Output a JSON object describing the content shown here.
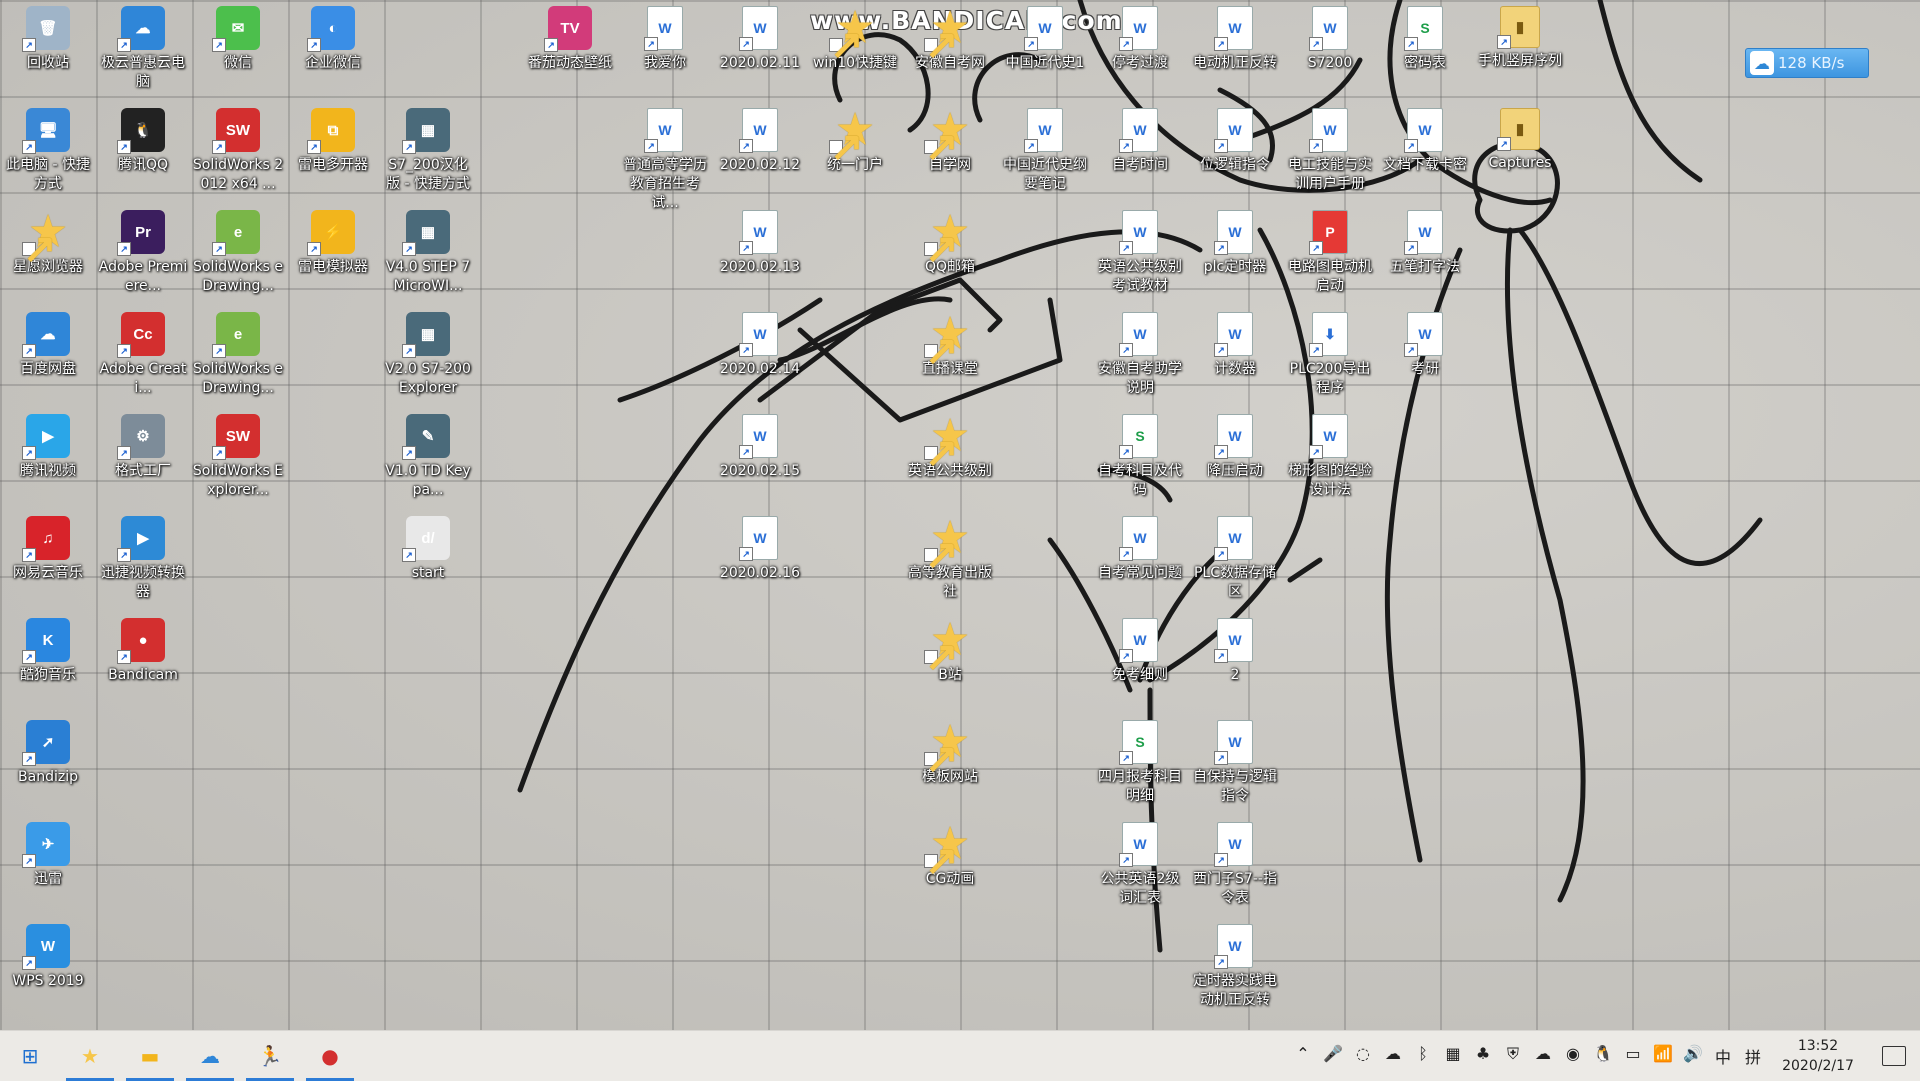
{
  "watermark": "www.BANDICAM.com",
  "download_speed": "128 KB/s",
  "icons": [
    {
      "label": "回收站",
      "glyph": "🗑",
      "kind": "app",
      "color": "#9fb4c8"
    },
    {
      "label": "极云普惠云电脑",
      "glyph": "☁",
      "kind": "app",
      "color": "#2f86d8"
    },
    {
      "label": "微信",
      "glyph": "✉",
      "kind": "app",
      "color": "#4cbf4c"
    },
    {
      "label": "企业微信",
      "glyph": "◐",
      "kind": "app",
      "color": "#3a8ee6"
    },
    {
      "label": "番茄动态壁纸",
      "glyph": "TV",
      "kind": "app",
      "color": "#d23b7a"
    },
    {
      "label": "我爱你",
      "glyph": "W",
      "kind": "doc"
    },
    {
      "label": "2020.02.11",
      "glyph": "W",
      "kind": "doc"
    },
    {
      "label": "win10快捷键",
      "glyph": "★",
      "kind": "star"
    },
    {
      "label": "安徽自考网",
      "glyph": "★",
      "kind": "star"
    },
    {
      "label": "中国近代史1",
      "glyph": "W",
      "kind": "doc"
    },
    {
      "label": "停考过渡",
      "glyph": "W",
      "kind": "doc"
    },
    {
      "label": "电动机正反转",
      "glyph": "W",
      "kind": "doc"
    },
    {
      "label": "S7200",
      "glyph": "W",
      "kind": "doc"
    },
    {
      "label": "密码表",
      "glyph": "S",
      "kind": "doc-green"
    },
    {
      "label": "手机竖屏序列",
      "glyph": "▮",
      "kind": "folder"
    },
    {
      "label": "此电脑 - 快捷方式",
      "glyph": "🖥",
      "kind": "app",
      "color": "#3a88d6"
    },
    {
      "label": "腾讯QQ",
      "glyph": "🐧",
      "kind": "app",
      "color": "#222"
    },
    {
      "label": "SolidWorks 2012 x64 ...",
      "glyph": "SW",
      "kind": "app",
      "color": "#d32f2f"
    },
    {
      "label": "雷电多开器",
      "glyph": "⧉",
      "kind": "app",
      "color": "#f2b51c"
    },
    {
      "label": "S7_200汉化版 - 快捷方式",
      "glyph": "▦",
      "kind": "app",
      "color": "#4a6a7a"
    },
    {
      "label": "普通高等学历教育招生考试...",
      "glyph": "W",
      "kind": "doc"
    },
    {
      "label": "2020.02.12",
      "glyph": "W",
      "kind": "doc"
    },
    {
      "label": "统一门户",
      "glyph": "★",
      "kind": "star"
    },
    {
      "label": "自学网",
      "glyph": "★",
      "kind": "star"
    },
    {
      "label": "中国近代史纲要笔记",
      "glyph": "W",
      "kind": "doc"
    },
    {
      "label": "自考时间",
      "glyph": "W",
      "kind": "doc"
    },
    {
      "label": "位逻辑指令",
      "glyph": "W",
      "kind": "doc"
    },
    {
      "label": "电工技能与实训用户手册",
      "glyph": "W",
      "kind": "doc"
    },
    {
      "label": "文档下载卡密",
      "glyph": "W",
      "kind": "doc"
    },
    {
      "label": "Captures",
      "glyph": "▮",
      "kind": "folder"
    },
    {
      "label": "星愿浏览器",
      "glyph": "★",
      "kind": "star"
    },
    {
      "label": "Adobe Premiere...",
      "glyph": "Pr",
      "kind": "app",
      "color": "#3b1e5e"
    },
    {
      "label": "SolidWorks eDrawing...",
      "glyph": "e",
      "kind": "app",
      "color": "#7ab648"
    },
    {
      "label": "雷电模拟器",
      "glyph": "⚡",
      "kind": "app",
      "color": "#f2b51c"
    },
    {
      "label": "V4.0 STEP 7 MicroWI...",
      "glyph": "▦",
      "kind": "app",
      "color": "#4a6a7a"
    },
    {
      "label": "2020.02.13",
      "glyph": "W",
      "kind": "doc"
    },
    {
      "label": "QQ邮箱",
      "glyph": "★",
      "kind": "star"
    },
    {
      "label": "英语公共级别考试教材",
      "glyph": "W",
      "kind": "doc"
    },
    {
      "label": "plc定时器",
      "glyph": "W",
      "kind": "doc"
    },
    {
      "label": "电路图电动机启动",
      "glyph": "P",
      "kind": "doc-red"
    },
    {
      "label": "五笔打字法",
      "glyph": "W",
      "kind": "doc"
    },
    {
      "label": "百度网盘",
      "glyph": "☁",
      "kind": "app",
      "color": "#2f86d8"
    },
    {
      "label": "Adobe Creati...",
      "glyph": "Cc",
      "kind": "app",
      "color": "#d32f2f"
    },
    {
      "label": "SolidWorks eDrawing...",
      "glyph": "e",
      "kind": "app",
      "color": "#7ab648"
    },
    {
      "label": "V2.0 S7-200 Explorer",
      "glyph": "▦",
      "kind": "app",
      "color": "#4a6a7a"
    },
    {
      "label": "2020.02.14",
      "glyph": "W",
      "kind": "doc"
    },
    {
      "label": "直播课堂",
      "glyph": "★",
      "kind": "star"
    },
    {
      "label": "安徽自考助学说明",
      "glyph": "W",
      "kind": "doc"
    },
    {
      "label": "计数器",
      "glyph": "W",
      "kind": "doc"
    },
    {
      "label": "PLC200导出程序",
      "glyph": "⬇",
      "kind": "doc"
    },
    {
      "label": "考研",
      "glyph": "W",
      "kind": "doc"
    },
    {
      "label": "腾讯视频",
      "glyph": "▶",
      "kind": "app",
      "color": "#2aa6e8"
    },
    {
      "label": "格式工厂",
      "glyph": "⚙",
      "kind": "app",
      "color": "#7d8c99"
    },
    {
      "label": "SolidWorks Explorer...",
      "glyph": "SW",
      "kind": "app",
      "color": "#d32f2f"
    },
    {
      "label": "V1.0 TD Keypa...",
      "glyph": "✎",
      "kind": "app",
      "color": "#4a6a7a"
    },
    {
      "label": "2020.02.15",
      "glyph": "W",
      "kind": "doc"
    },
    {
      "label": "英语公共级别",
      "glyph": "★",
      "kind": "star"
    },
    {
      "label": "自考科目及代码",
      "glyph": "S",
      "kind": "doc-green"
    },
    {
      "label": "降压启动",
      "glyph": "W",
      "kind": "doc"
    },
    {
      "label": "梯形图的经验设计法",
      "glyph": "W",
      "kind": "doc"
    },
    {
      "label": "网易云音乐",
      "glyph": "♫",
      "kind": "app",
      "color": "#d8232a"
    },
    {
      "label": "迅捷视频转换器",
      "glyph": "▶",
      "kind": "app",
      "color": "#2d8ad6"
    },
    {
      "label": "start",
      "glyph": "d/",
      "kind": "app",
      "color": "#e8e8e8"
    },
    {
      "label": "2020.02.16",
      "glyph": "W",
      "kind": "doc"
    },
    {
      "label": "高等教育出版社",
      "glyph": "★",
      "kind": "star"
    },
    {
      "label": "自考常见问题",
      "glyph": "W",
      "kind": "doc"
    },
    {
      "label": "PLC数据存储区",
      "glyph": "W",
      "kind": "doc"
    },
    {
      "label": "酷狗音乐",
      "glyph": "K",
      "kind": "app",
      "color": "#2a87e0"
    },
    {
      "label": "Bandicam",
      "glyph": "●",
      "kind": "app",
      "color": "#d32f2f"
    },
    {
      "label": "B站",
      "glyph": "★",
      "kind": "star"
    },
    {
      "label": "免考细则",
      "glyph": "W",
      "kind": "doc"
    },
    {
      "label": "2",
      "glyph": "W",
      "kind": "doc"
    },
    {
      "label": "Bandizip",
      "glyph": "➚",
      "kind": "app",
      "color": "#2a7fd4"
    },
    {
      "label": "模板网站",
      "glyph": "★",
      "kind": "star"
    },
    {
      "label": "四月报考科目明细",
      "glyph": "S",
      "kind": "doc-green"
    },
    {
      "label": "自保持与逻辑指令",
      "glyph": "W",
      "kind": "doc"
    },
    {
      "label": "迅雷",
      "glyph": "✈",
      "kind": "app",
      "color": "#3a9be8"
    },
    {
      "label": "CG动画",
      "glyph": "★",
      "kind": "star"
    },
    {
      "label": "公共英语2级词汇表",
      "glyph": "W",
      "kind": "doc"
    },
    {
      "label": "西门子S7--指令表",
      "glyph": "W",
      "kind": "doc"
    },
    {
      "label": "WPS 2019",
      "glyph": "W",
      "kind": "app",
      "color": "#2a8fe0"
    },
    {
      "label": "定时器实践电动机正反转",
      "glyph": "W",
      "kind": "doc"
    }
  ],
  "taskbar": {
    "apps": [
      {
        "name": "start-button",
        "glyph": "⊞",
        "active": false
      },
      {
        "name": "browser-star",
        "glyph": "★",
        "active": true
      },
      {
        "name": "file-explorer",
        "glyph": "▬",
        "active": true
      },
      {
        "name": "baidu-netdisk",
        "glyph": "☁",
        "active": true
      },
      {
        "name": "runner-app",
        "glyph": "🏃",
        "active": true
      },
      {
        "name": "bandicam-record",
        "glyph": "●",
        "active": true
      }
    ],
    "tray": [
      "⌃",
      "🎤",
      "◌",
      "☁",
      "ᛒ",
      "▦",
      "♣",
      "⛨",
      "☁",
      "◉",
      "🐧",
      "▭",
      "📶",
      "🔊",
      "中",
      "拼"
    ],
    "time": "13:52",
    "date": "2020/2/17"
  }
}
